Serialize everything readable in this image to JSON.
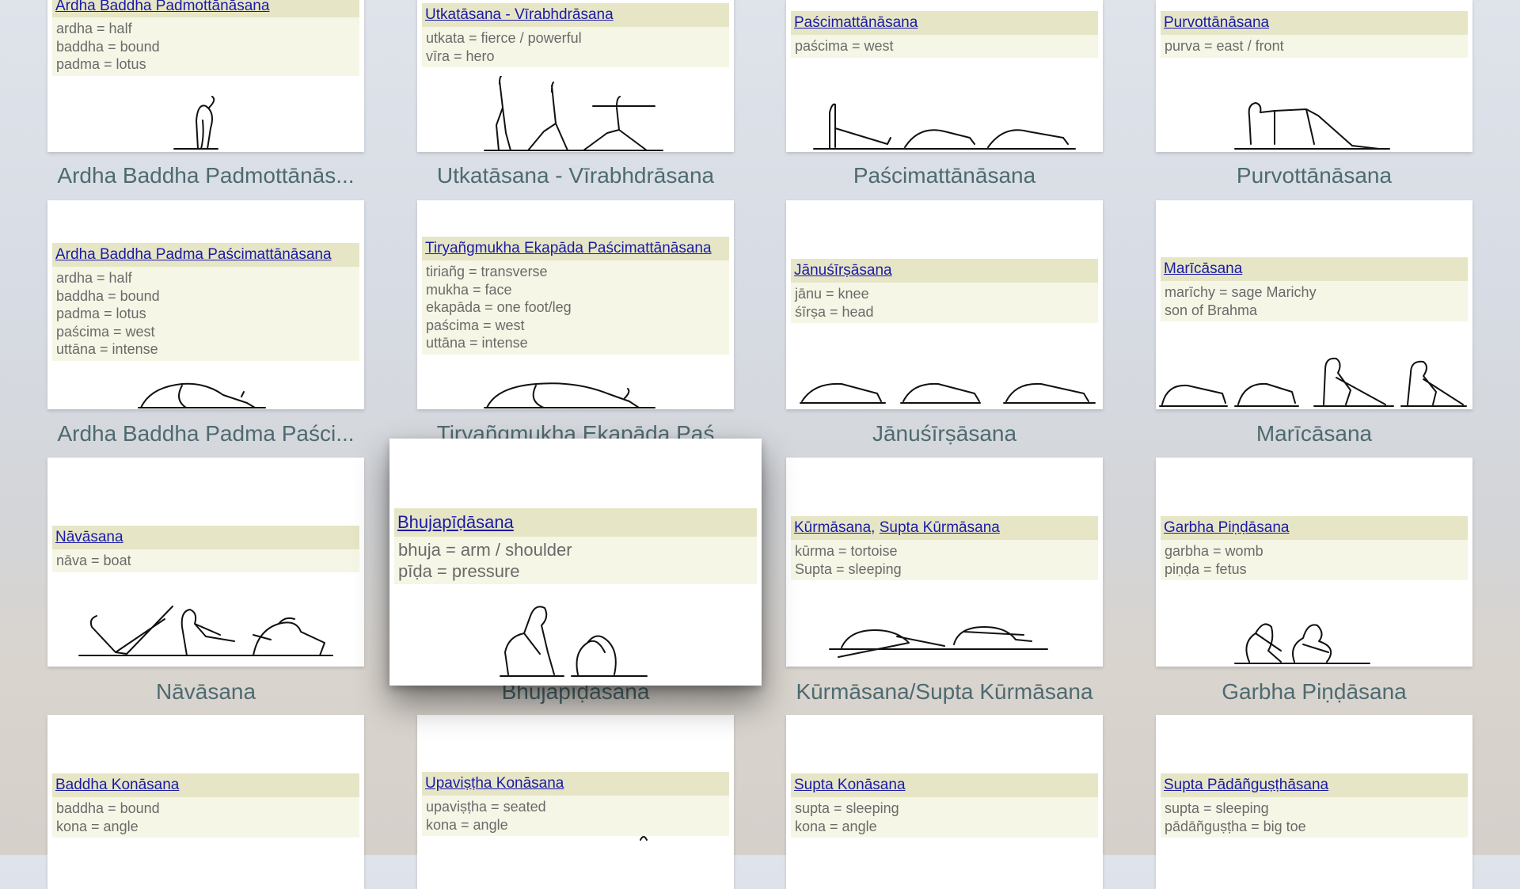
{
  "colors": {
    "link": "#1a1aa6",
    "header_bg": "#e6e6c7",
    "body_bg": "#f6f6e6",
    "caption": "#4e6a70"
  },
  "cards": [
    {
      "title_links": [
        "Ardha Baddha Padmottānāsana"
      ],
      "lines": [
        "ardha = half",
        "baddha = bound",
        "padma = lotus"
      ],
      "caption": "Ardha Baddha Padmottānās..."
    },
    {
      "title_links": [
        "Utkatāsana - Vīrabhdrāsana"
      ],
      "lines": [
        "utkata = fierce / powerful",
        "vīra = hero"
      ],
      "caption": "Utkatāsana - Vīrabhdrāsana"
    },
    {
      "title_links": [
        "Paścimattānāsana"
      ],
      "lines": [
        "paścima = west"
      ],
      "caption": "Paścimattānāsana"
    },
    {
      "title_links": [
        "Purvottānāsana"
      ],
      "lines": [
        "purva = east / front"
      ],
      "caption": "Purvottānāsana"
    },
    {
      "title_links": [
        "Ardha Baddha Padma Paścimattānāsana"
      ],
      "lines": [
        "ardha = half",
        "baddha = bound",
        "padma = lotus",
        "paścima = west",
        "uttāna = intense"
      ],
      "caption": "Ardha Baddha Padma Paści..."
    },
    {
      "title_links": [
        "Tiryañgmukha Ekapāda Paścimattānāsana"
      ],
      "lines": [
        "tiriañg = transverse",
        "mukha = face",
        "ekapāda = one foot/leg",
        "paścima = west",
        "uttāna = intense"
      ],
      "caption": "Tiryañgmukha Ekapāda Paś"
    },
    {
      "title_links": [
        "Jānuśīrṣāsana"
      ],
      "lines": [
        "jānu = knee",
        "śīrṣa = head"
      ],
      "caption": "Jānuśīrṣāsana"
    },
    {
      "title_links": [
        "Marīcāsana"
      ],
      "lines": [
        "marīchy = sage Marichy",
        "son of Brahma"
      ],
      "caption": "Marīcāsana"
    },
    {
      "title_links": [
        "Nāvāsana"
      ],
      "lines": [
        "nāva = boat"
      ],
      "caption": "Nāvāsana"
    },
    {
      "title_links": [
        "Bhujapīḍāsana"
      ],
      "lines": [
        "bhuja = arm / shoulder",
        "pīḍa = pressure"
      ],
      "caption": "Bhujapīḍāsana"
    },
    {
      "title_links": [
        "Kūrmāsana",
        "Supta Kūrmāsana"
      ],
      "title_sep": ", ",
      "lines": [
        "kūrma = tortoise",
        "Supta = sleeping"
      ],
      "caption": "Kūrmāsana/Supta Kūrmāsana"
    },
    {
      "title_links": [
        "Garbha Piṇḍāsana"
      ],
      "lines": [
        "garbha = womb",
        "piṇḍa = fetus"
      ],
      "caption": "Garbha Piṇḍāsana"
    },
    {
      "title_links": [
        "Baddha Konāsana"
      ],
      "lines": [
        "baddha = bound",
        "kona = angle"
      ],
      "caption": ""
    },
    {
      "title_links": [
        "Upaviṣṭha Konāsana"
      ],
      "lines": [
        "upaviṣṭha = seated",
        "kona = angle"
      ],
      "caption": ""
    },
    {
      "title_links": [
        "Supta Konāsana"
      ],
      "lines": [
        "supta = sleeping",
        "kona = angle"
      ],
      "caption": ""
    },
    {
      "title_links": [
        "Supta Pādāñguṣṭhāsana"
      ],
      "lines": [
        "supta = sleeping",
        "pādāñguṣṭha = big toe"
      ],
      "caption": ""
    }
  ]
}
